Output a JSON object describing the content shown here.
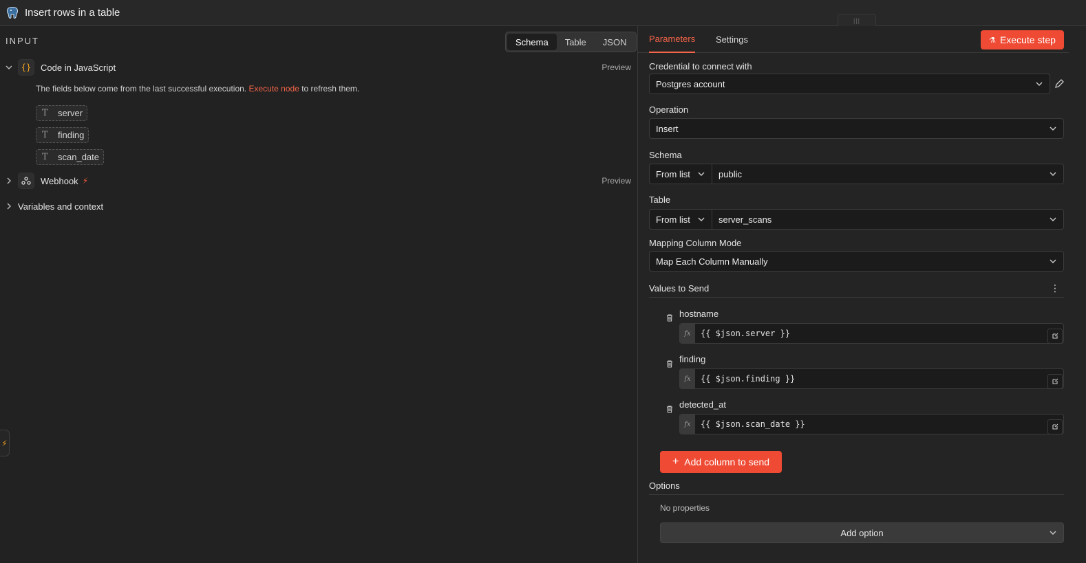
{
  "header": {
    "title": "Insert rows in a table",
    "logo_icon": "postgres-elephant-icon",
    "grip_icon": "drag-grip-icon"
  },
  "input_panel": {
    "label": "INPUT",
    "view_modes": [
      "Schema",
      "Table",
      "JSON"
    ],
    "active_view": "Schema",
    "nodes": [
      {
        "name": "Code in JavaScript",
        "icon": "code-braces-icon",
        "expanded": true,
        "action": "Preview"
      },
      {
        "name": "Webhook",
        "icon": "webhook-icon",
        "expanded": false,
        "action": "Preview",
        "trigger_icon": "lightning-bolt-icon"
      }
    ],
    "note": {
      "before": "The fields below come from the last successful execution.",
      "link": "Execute node",
      "after": "to refresh them."
    },
    "fields": [
      "server",
      "finding",
      "scan_date"
    ],
    "variables_label": "Variables and context"
  },
  "params_panel": {
    "tabs": [
      "Parameters",
      "Settings"
    ],
    "active_tab": "Parameters",
    "execute_label": "Execute step",
    "credential": {
      "label": "Credential to connect with",
      "value": "Postgres account"
    },
    "operation": {
      "label": "Operation",
      "value": "Insert"
    },
    "schema": {
      "label": "Schema",
      "mode": "From list",
      "value": "public"
    },
    "table": {
      "label": "Table",
      "mode": "From list",
      "value": "server_scans"
    },
    "mapping": {
      "label": "Mapping Column Mode",
      "value": "Map Each Column Manually"
    },
    "values_to_send": {
      "label": "Values to Send",
      "items": [
        {
          "name": "hostname",
          "expression": "{{ $json.server }}"
        },
        {
          "name": "finding",
          "expression": "{{ $json.finding }}"
        },
        {
          "name": "detected_at",
          "expression": "{{ $json.scan_date }}"
        }
      ],
      "fx_label": "fx",
      "add_label": "Add column to send"
    },
    "options": {
      "label": "Options",
      "empty_text": "No properties",
      "add_label": "Add option"
    }
  },
  "colors": {
    "accent": "#ef4a33",
    "link": "#f36549",
    "background": "#222222",
    "input_bg": "#1b1b1b"
  }
}
